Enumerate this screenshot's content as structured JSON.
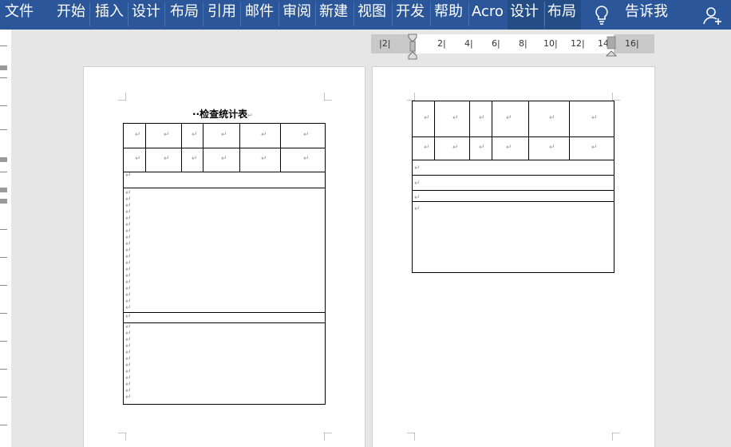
{
  "ribbon": {
    "tabs": [
      "文件",
      "开始",
      "插入",
      "设计",
      "布局",
      "引用",
      "邮件",
      "审阅",
      "新建",
      "视图",
      "开发",
      "帮助",
      "Acro",
      "设计",
      "布局"
    ],
    "tell_me": "告诉我",
    "icons": {
      "lightbulb": "lightbulb-icon",
      "share": "share-person-icon"
    },
    "colors": {
      "bar": "#2b579a",
      "active_tab": "#244d86"
    }
  },
  "ruler": {
    "labels": [
      "2",
      "2",
      "4",
      "6",
      "8",
      "10",
      "12",
      "14",
      "16"
    ]
  },
  "document": {
    "title": "··检查统计表",
    "paragraph_mark": "↵"
  }
}
